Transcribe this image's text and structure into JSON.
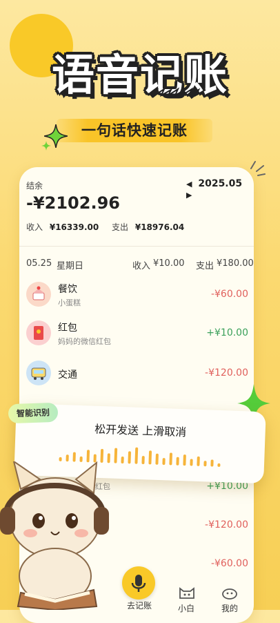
{
  "promo": {
    "headline": "语音记账",
    "subline": "一句话快速记账"
  },
  "summary": {
    "balance_label": "结余",
    "month": "2025.05",
    "balance": "-¥2102.96",
    "income_label": "收入",
    "income_value": "¥16339.00",
    "expense_label": "支出",
    "expense_value": "¥18976.04"
  },
  "day": {
    "date": "05.25",
    "weekday": "星期日",
    "income_label": "收入",
    "income_value": "¥10.00",
    "expense_label": "支出",
    "expense_value": "¥180.00"
  },
  "transactions": [
    {
      "category": "餐饮",
      "note": "小蛋糕",
      "amount": "-¥60.00",
      "icon": "cake-icon"
    },
    {
      "category": "红包",
      "note": "妈妈的微信红包",
      "amount": "+¥10.00",
      "icon": "red-envelope-icon"
    },
    {
      "category": "交通",
      "note": "",
      "amount": "-¥120.00",
      "icon": "bus-icon"
    }
  ],
  "lower_rows": [
    {
      "note": "红包",
      "amount": "+¥10.00"
    },
    {
      "note": "",
      "amount": "-¥120.00"
    },
    {
      "note": "",
      "amount": "-¥60.00"
    }
  ],
  "voice": {
    "tag": "智能识别",
    "hint": "松开发送 上滑取消"
  },
  "nav": {
    "record": "去记账",
    "pet": "小白",
    "mine": "我的"
  },
  "colors": {
    "accent": "#f9c928",
    "negative": "#e0605c",
    "positive": "#3aa05a"
  }
}
